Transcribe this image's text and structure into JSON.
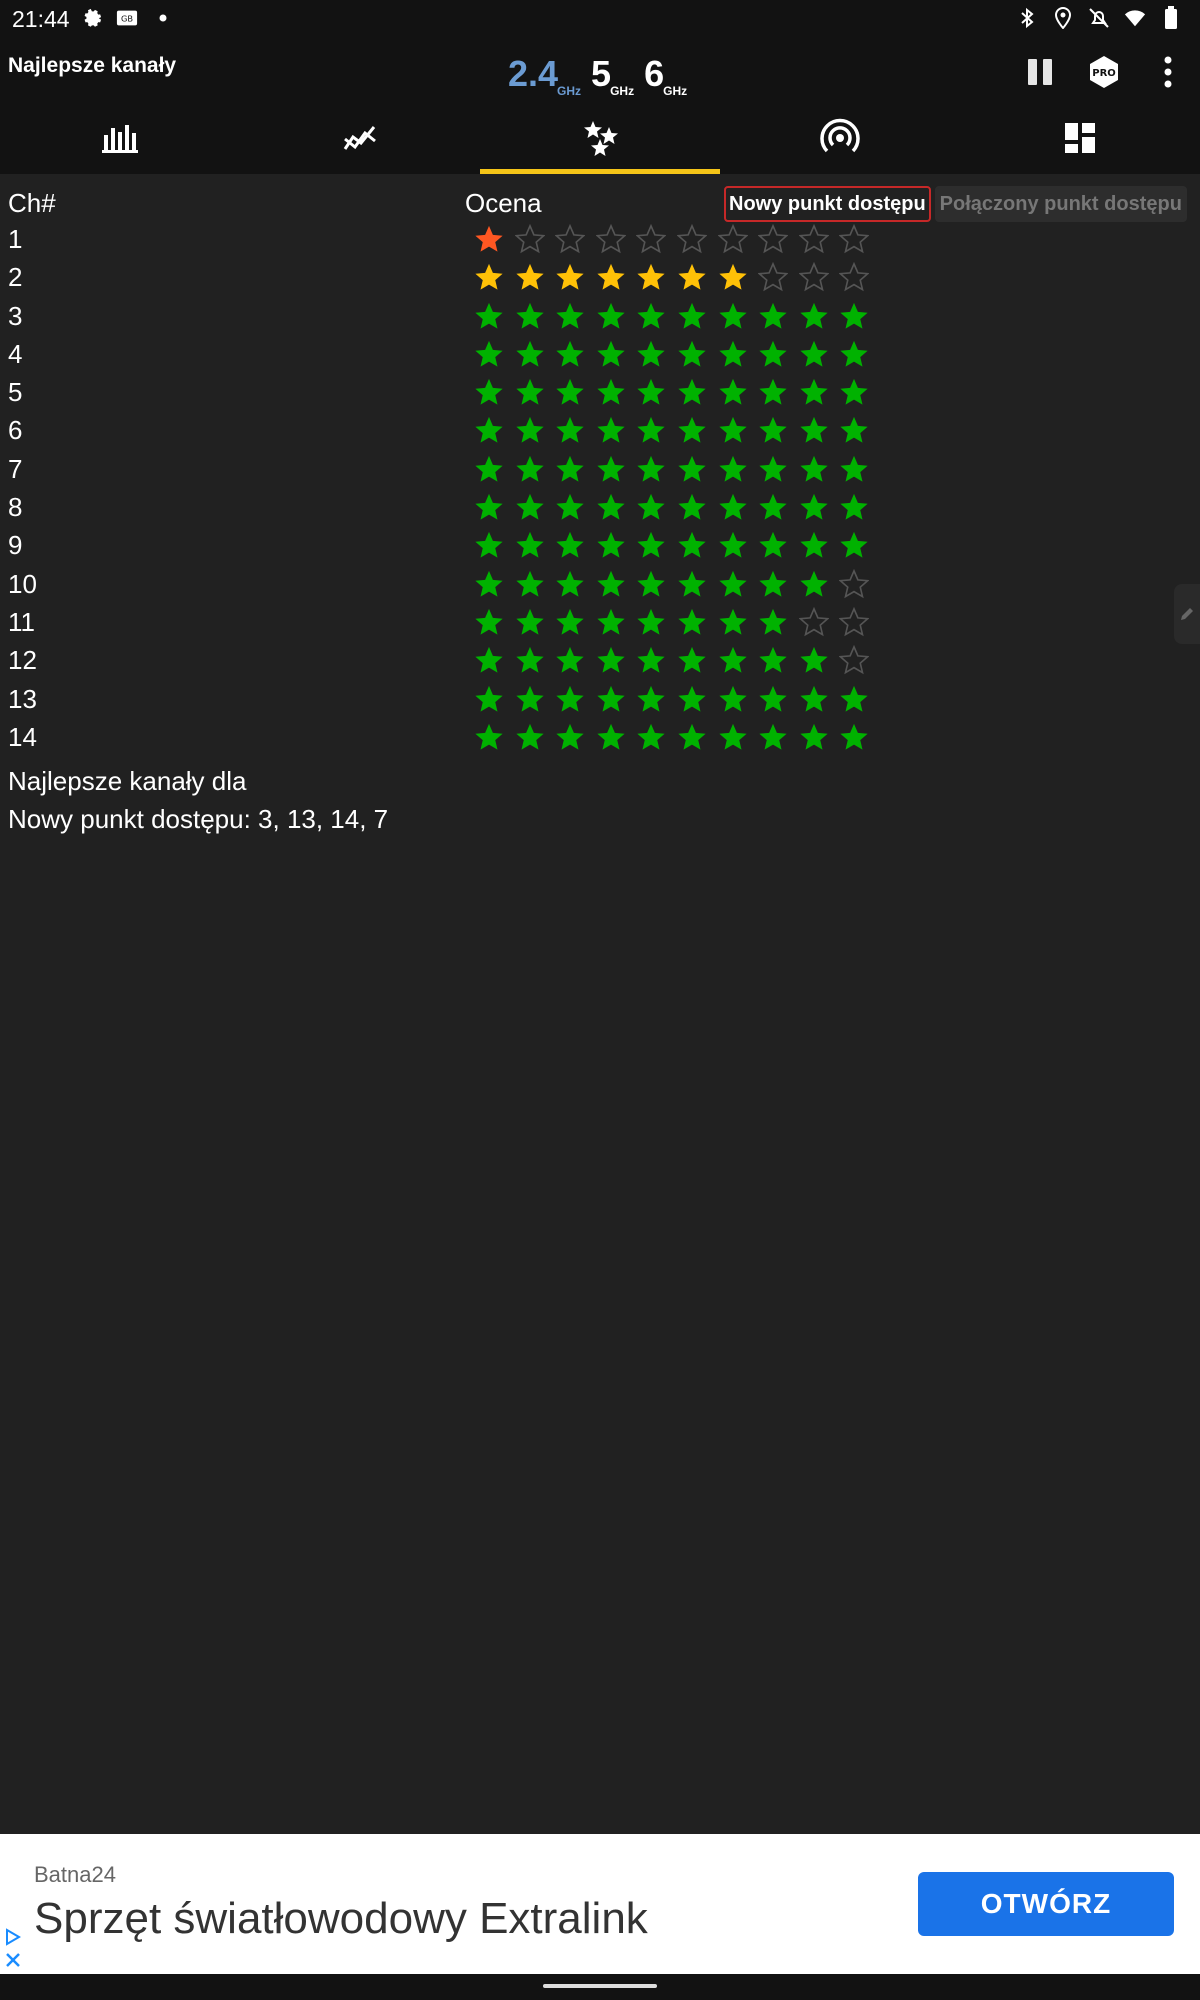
{
  "status_bar": {
    "time": "21:44",
    "left_icons": [
      "gear-icon",
      "card-icon",
      "dot-icon"
    ],
    "right_icons": [
      "bluetooth-icon",
      "location-icon",
      "bell-off-icon",
      "wifi-icon",
      "battery-icon"
    ]
  },
  "app_bar": {
    "title": "Najlepsze kanały",
    "bands": [
      {
        "value": "2.4",
        "unit": "GHz",
        "active": true
      },
      {
        "value": "5",
        "unit": "GHz",
        "active": false
      },
      {
        "value": "6",
        "unit": "GHz",
        "active": false
      }
    ],
    "pro_label": "PRO",
    "actions": [
      "pause-icon",
      "pro-badge-icon",
      "more-vert-icon"
    ]
  },
  "tabs": [
    {
      "icon": "bar-chart-icon",
      "active": false
    },
    {
      "icon": "time-graph-icon",
      "active": false
    },
    {
      "icon": "stars-icon",
      "active": true
    },
    {
      "icon": "access-point-icon",
      "active": false
    },
    {
      "icon": "dashboard-icon",
      "active": false
    }
  ],
  "table": {
    "col_channel": "Ch#",
    "col_rating": "Ocena",
    "toggle": {
      "selected": "Nowy punkt dostępu",
      "other": "Połączony punkt dostępu"
    },
    "max_stars": 10,
    "rows": [
      {
        "ch": "1",
        "stars": 1,
        "color": "#ff5722"
      },
      {
        "ch": "2",
        "stars": 7,
        "color": "#ffc107"
      },
      {
        "ch": "3",
        "stars": 10,
        "color": "#00b200"
      },
      {
        "ch": "4",
        "stars": 10,
        "color": "#00b200"
      },
      {
        "ch": "5",
        "stars": 10,
        "color": "#00b200"
      },
      {
        "ch": "6",
        "stars": 10,
        "color": "#00b200"
      },
      {
        "ch": "7",
        "stars": 10,
        "color": "#00b200"
      },
      {
        "ch": "8",
        "stars": 10,
        "color": "#00b200"
      },
      {
        "ch": "9",
        "stars": 10,
        "color": "#00b200"
      },
      {
        "ch": "10",
        "stars": 9,
        "color": "#00b200"
      },
      {
        "ch": "11",
        "stars": 8,
        "color": "#00b200"
      },
      {
        "ch": "12",
        "stars": 9,
        "color": "#00b200"
      },
      {
        "ch": "13",
        "stars": 10,
        "color": "#00b200"
      },
      {
        "ch": "14",
        "stars": 10,
        "color": "#00b200"
      }
    ],
    "empty_star_color": "#555555"
  },
  "best": {
    "line1": "Najlepsze kanały dla",
    "line2": "Nowy punkt dostępu: 3, 13, 14, 7"
  },
  "ad": {
    "advertiser": "Batna24",
    "headline": "Sprzęt światłowodowy Extralink",
    "cta": "OTWÓRZ"
  }
}
